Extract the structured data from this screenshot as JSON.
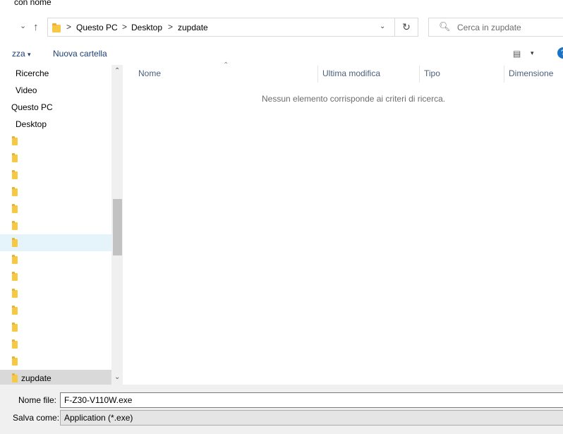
{
  "window": {
    "title_fragment": "con nome"
  },
  "nav_buttons": {
    "dropdown": "⌄",
    "up": "↑"
  },
  "address": {
    "crumbs": [
      "Questo PC",
      "Desktop",
      "zupdate"
    ],
    "separator": ">",
    "dropdown": "⌄",
    "refresh": "↻"
  },
  "search": {
    "placeholder": "Cerca in zupdate",
    "icon": "search-icon"
  },
  "toolbar": {
    "organize_label": "zza",
    "organize_arrow": "▾",
    "new_folder_label": "Nuova cartella",
    "view_icon": "▤",
    "view_arrow": "▾",
    "help_label": "?"
  },
  "navigation_pane": {
    "items": [
      {
        "label": "Ricerche",
        "icon": "none"
      },
      {
        "label": "Video",
        "icon": "none"
      },
      {
        "label": "Questo PC",
        "icon": "none"
      },
      {
        "label": "Desktop",
        "icon": "none"
      },
      {
        "label": "",
        "icon": "folder-icon"
      },
      {
        "label": "",
        "icon": "folder-icon"
      },
      {
        "label": "",
        "icon": "folder-icon"
      },
      {
        "label": "",
        "icon": "folder-icon"
      },
      {
        "label": "",
        "icon": "folder-icon"
      },
      {
        "label": "",
        "icon": "folder-icon"
      },
      {
        "label": "",
        "icon": "folder-icon"
      },
      {
        "label": "",
        "icon": "folder-icon"
      },
      {
        "label": "",
        "icon": "folder-icon"
      },
      {
        "label": "",
        "icon": "folder-icon"
      },
      {
        "label": "",
        "icon": "folder-icon"
      },
      {
        "label": "",
        "icon": "folder-icon"
      },
      {
        "label": "",
        "icon": "folder-icon"
      },
      {
        "label": "",
        "icon": "folder-icon"
      },
      {
        "label": "zupdate",
        "icon": "folder-icon"
      }
    ],
    "scroll_up": "⌃",
    "scroll_down": "⌄"
  },
  "file_list": {
    "columns": [
      "Nome",
      "Ultima modifica",
      "Tipo",
      "Dimensione"
    ],
    "sort_indicator": "⌃",
    "empty_message": "Nessun elemento corrisponde ai criteri di ricerca."
  },
  "bottom": {
    "filename_label": "Nome file:",
    "filename_value": "F-Z30-V110W.exe",
    "save_as_label": "Salva come:",
    "save_as_value": "Application (*.exe)"
  }
}
